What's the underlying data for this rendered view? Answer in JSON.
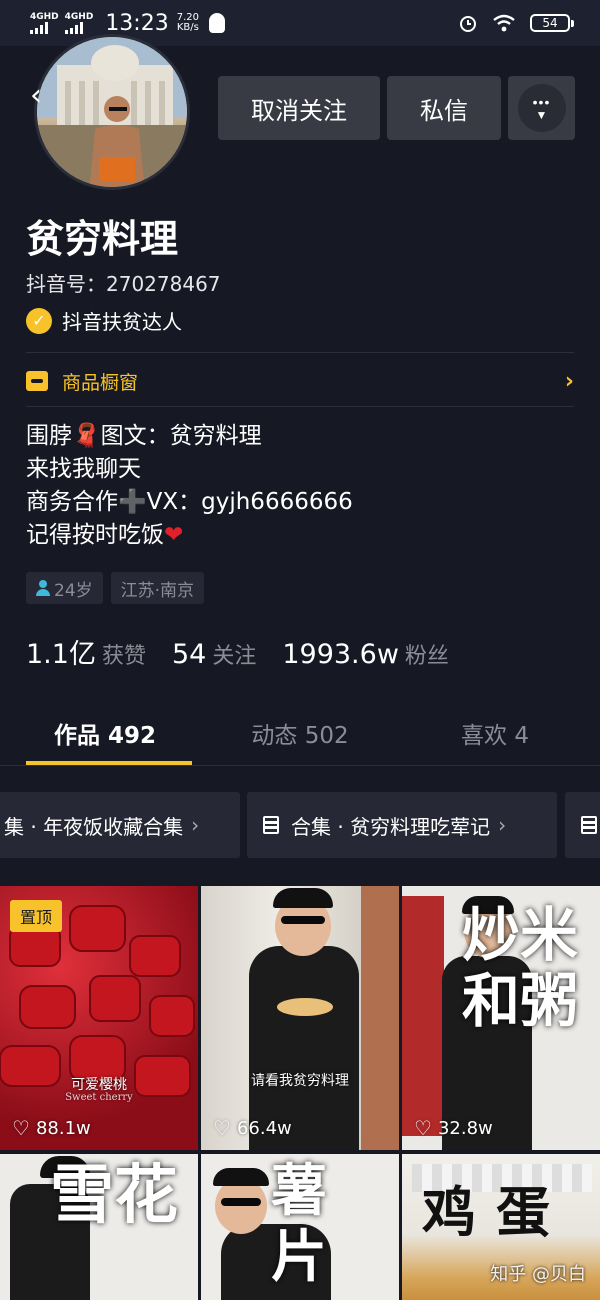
{
  "status_bar": {
    "network1": "4GHD",
    "network2": "4GHD",
    "time": "13:23",
    "speed_value": "7.20",
    "speed_unit": "KB/s",
    "battery": "54"
  },
  "header": {
    "unfollow_label": "取消关注",
    "message_label": "私信",
    "more_label": "•••"
  },
  "profile": {
    "name": "贫穷料理",
    "douyin_id": "抖音号：270278467",
    "verified_label": "抖音扶贫达人",
    "shop_label": "商品橱窗",
    "bio": {
      "line1_a": "围脖",
      "line1_emoji": "🧣",
      "line1_b": "图文：贫穷料理",
      "line2": "来找我聊天",
      "line3_a": "商务合作",
      "line3_emoji": "➕",
      "line3_b": "VX：gyjh6666666",
      "line4_a": "记得按时吃饭",
      "line4_emoji": "❤"
    },
    "tags": {
      "age": "24岁",
      "location": "江苏·南京"
    }
  },
  "stats": {
    "likes_value": "1.1亿",
    "likes_label": "获赞",
    "following_value": "54",
    "following_label": "关注",
    "followers_value": "1993.6w",
    "followers_label": "粉丝"
  },
  "tabs": [
    {
      "label": "作品 492"
    },
    {
      "label": "动态 502"
    },
    {
      "label": "喜欢 4"
    }
  ],
  "collections": [
    {
      "label": "集 · 年夜饭收藏合集"
    },
    {
      "label": "合集 · 贫穷料理吃荤记"
    }
  ],
  "videos": [
    {
      "likes": "88.1w",
      "pinned_label": "置顶",
      "caption": "可爱樱桃",
      "caption_sub": "Sweet cherry"
    },
    {
      "likes": "66.4w",
      "caption": "请看我贫穷料理"
    },
    {
      "likes": "32.8w",
      "title_chars": "炒米和粥"
    },
    {
      "title_chars": "雪花"
    },
    {
      "title_chars": "薯片"
    },
    {
      "title_chars": "鸡蛋",
      "watermark": "知乎 @贝白"
    }
  ],
  "colors": {
    "accent": "#f7c22a",
    "background": "#161823"
  }
}
